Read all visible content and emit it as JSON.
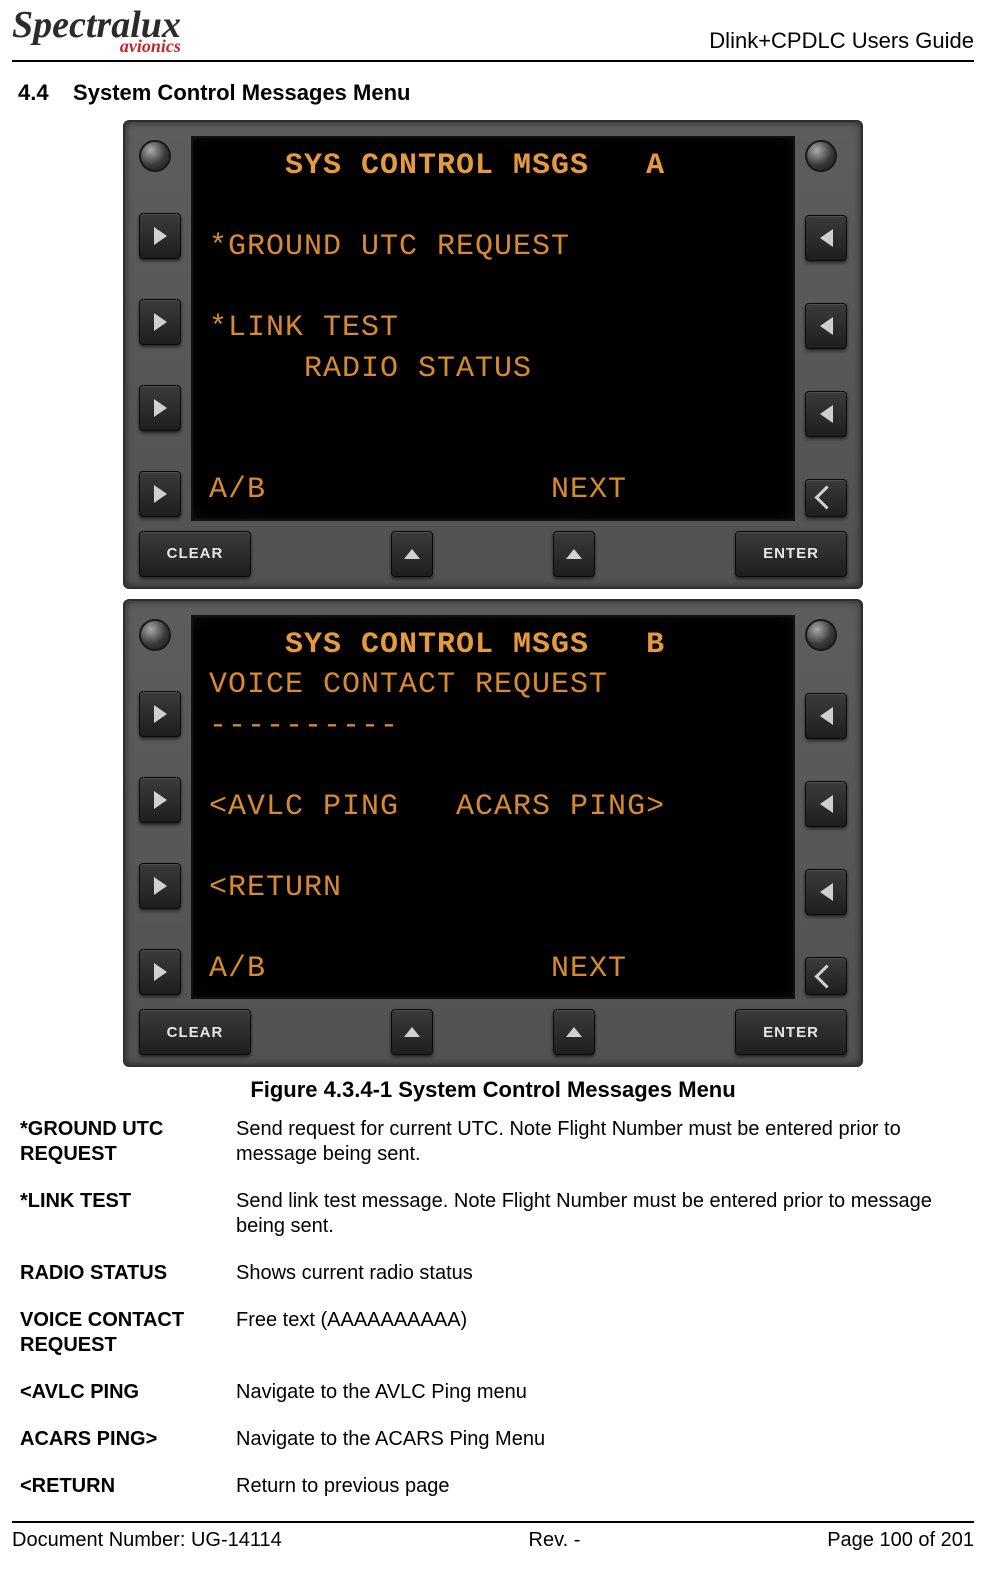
{
  "header": {
    "logo_main": "Spectralux",
    "logo_sub": "avionics",
    "doc_title": "Dlink+CPDLC Users Guide"
  },
  "section": {
    "number": "4.4",
    "title": "System Control Messages Menu"
  },
  "screens": [
    {
      "title_line": "    SYS CONTROL MSGS   A",
      "lines": [
        "",
        "*GROUND UTC REQUEST",
        "",
        "*LINK TEST",
        "     RADIO STATUS",
        "",
        "",
        "A/B               NEXT"
      ]
    },
    {
      "title_line": "    SYS CONTROL MSGS   B",
      "lines": [
        "VOICE CONTACT REQUEST",
        "----------",
        "",
        "<AVLC PING   ACARS PING>",
        "",
        "<RETURN",
        "",
        "A/B               NEXT"
      ]
    }
  ],
  "hw": {
    "clear": "CLEAR",
    "enter": "ENTER"
  },
  "figure_caption": "Figure 4.3.4-1 System Control Messages Menu",
  "definitions": [
    {
      "term": "*GROUND UTC REQUEST",
      "desc": "Send request for current UTC.  Note Flight Number must be entered prior to message being sent."
    },
    {
      "term": "*LINK TEST",
      "desc": "Send link test message.  Note Flight Number must be entered prior to message being sent."
    },
    {
      "term": "RADIO STATUS",
      "desc": "Shows current radio status"
    },
    {
      "term": "VOICE CONTACT REQUEST",
      "desc": "Free text (AAAAAAAAAA)"
    },
    {
      "term": "<AVLC PING",
      "desc": "Navigate to the AVLC Ping menu"
    },
    {
      "term": "ACARS PING>",
      "desc": "Navigate to the ACARS Ping Menu"
    },
    {
      "term": "<RETURN",
      "desc": "Return to previous page"
    }
  ],
  "footer": {
    "doc_num": "Document Number:  UG-14114",
    "rev": "Rev. -",
    "page": "Page 100 of 201"
  }
}
